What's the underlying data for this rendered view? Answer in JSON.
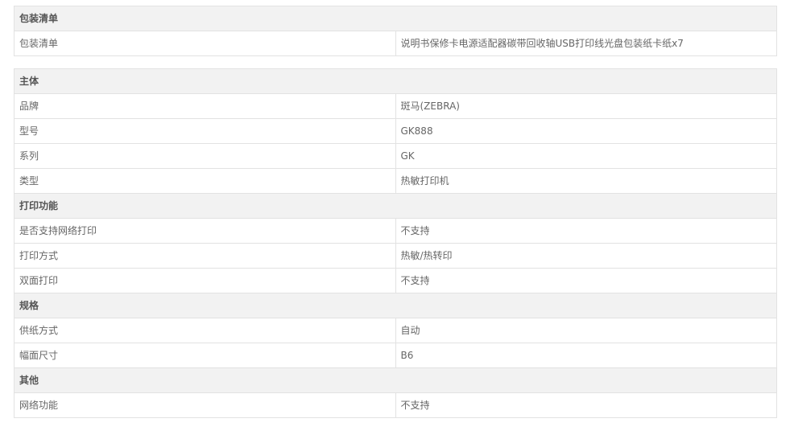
{
  "packing": {
    "section_title": "包装清单",
    "rows": [
      {
        "label": "包装清单",
        "value": "说明书保修卡电源适配器碳带回收轴USB打印线光盘包装纸卡纸x7"
      }
    ]
  },
  "specs": [
    {
      "section_title": "主体",
      "rows": [
        {
          "label": "品牌",
          "value": "斑马(ZEBRA)"
        },
        {
          "label": "型号",
          "value": "GK888"
        },
        {
          "label": "系列",
          "value": "GK"
        },
        {
          "label": "类型",
          "value": "热敏打印机"
        }
      ]
    },
    {
      "section_title": "打印功能",
      "rows": [
        {
          "label": "是否支持网络打印",
          "value": "不支持"
        },
        {
          "label": "打印方式",
          "value": "热敏/热转印"
        },
        {
          "label": "双面打印",
          "value": "不支持"
        }
      ]
    },
    {
      "section_title": "规格",
      "rows": [
        {
          "label": "供纸方式",
          "value": "自动"
        },
        {
          "label": "幅面尺寸",
          "value": "B6"
        }
      ]
    },
    {
      "section_title": "其他",
      "rows": [
        {
          "label": "网络功能",
          "value": "不支持"
        }
      ]
    }
  ]
}
